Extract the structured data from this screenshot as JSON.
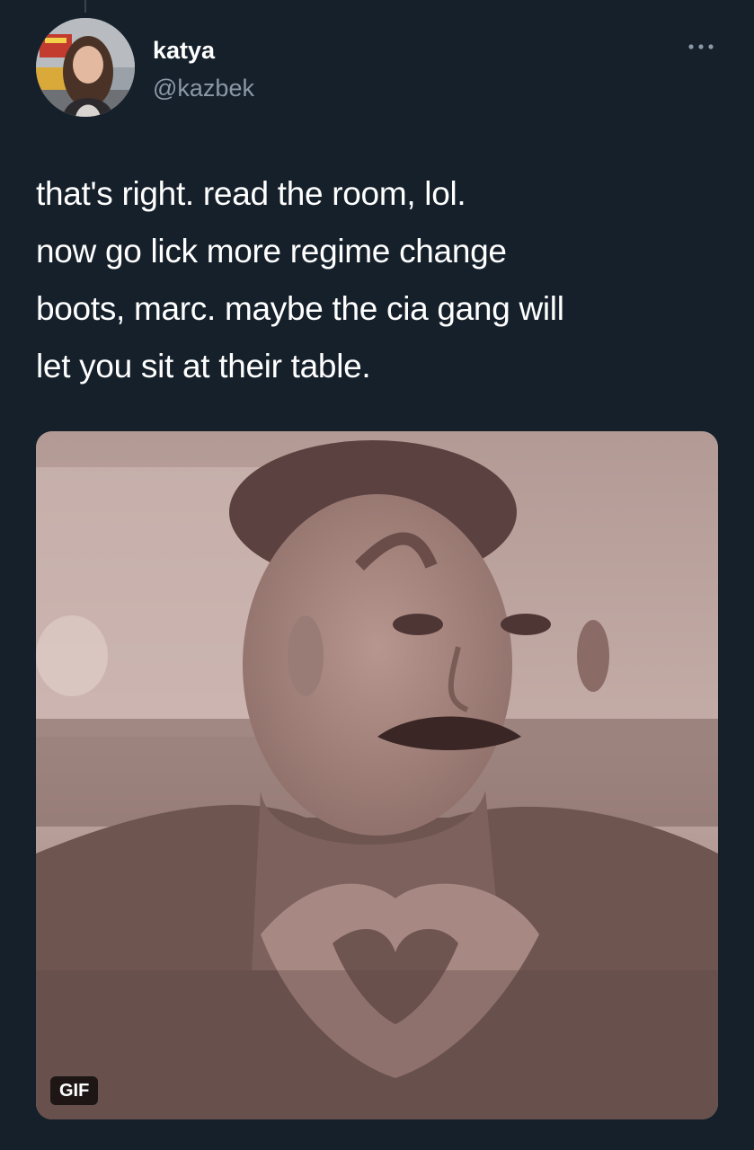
{
  "tweet": {
    "author": {
      "display_name": "katya",
      "handle": "@kazbek",
      "avatar_icon": "profile-photo"
    },
    "more_icon": "more-options-icon",
    "text_lines": [
      "that's right. read the room, lol.",
      "now go lick more regime change",
      "boots, marc. maybe the cia gang will",
      "let you sit at their table."
    ],
    "media": {
      "badge": "GIF",
      "icon": "gif-image"
    }
  },
  "colors": {
    "background": "#15202b",
    "text_primary": "#ffffff",
    "text_secondary": "#8b98a5"
  }
}
